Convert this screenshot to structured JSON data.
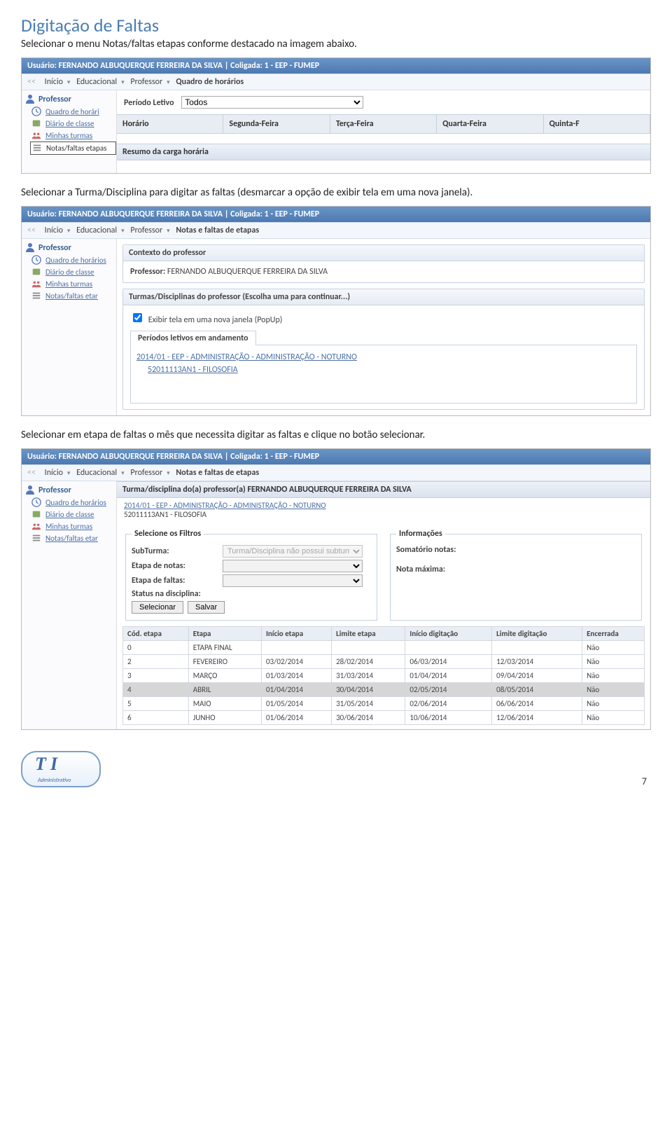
{
  "doc": {
    "title": "Digitação de Faltas",
    "intro1": "Selecionar o menu Notas/faltas etapas conforme destacado na imagem abaixo.",
    "intro2": "Selecionar a Turma/Disciplina para digitar as faltas (desmarcar a opção de exibir tela em uma nova janela).",
    "intro3": "Selecionar em etapa de faltas o mês que necessita digitar as faltas e clique no botão selecionar.",
    "page_number": "7",
    "logo_sub": "Administrativo"
  },
  "user_bar": "Usuário: FERNANDO ALBUQUERQUE FERREIRA DA SILVA  |  Coligada: 1 - EEP - FUMEP",
  "crumbs1": [
    "Início",
    "Educacional",
    "Professor",
    "Quadro de horários"
  ],
  "crumbs2": [
    "Início",
    "Educacional",
    "Professor",
    "Notas e faltas de etapas"
  ],
  "sidebar": {
    "group": "Professor",
    "items": [
      "Quadro de horári",
      "Diário de classe",
      "Minhas turmas",
      "Notas/faltas etapas"
    ],
    "items_b": [
      "Quadro de horários",
      "Diário de classe",
      "Minhas turmas",
      "Notas/faltas etar"
    ],
    "items_c": [
      "Quadro de horários",
      "Diário de classe",
      "Minhas turmas",
      "Notas/faltas etar"
    ]
  },
  "shot1": {
    "period_label": "Período Letivo",
    "period_value": "Todos",
    "cols": [
      "Horário",
      "Segunda-Feira",
      "Terça-Feira",
      "Quarta-Feira",
      "Quinta-F"
    ],
    "section": "Resumo da carga horária"
  },
  "shot2": {
    "panel1_title": "Contexto do professor",
    "prof_label": "Professor:",
    "prof_name": "FERNANDO ALBUQUERQUE FERREIRA DA SILVA",
    "panel2_title": "Turmas/Disciplinas do professor (Escolha uma para continuar...)",
    "chk_label": "Exibir tela em uma nova janela (PopUp)",
    "tab_label": "Períodos letivos em andamento",
    "row1": "2014/01 - EEP - ADMINISTRAÇÃO - ADMINISTRAÇÃO - NOTURNO",
    "row2": "52011113AN1 - FILOSOFIA"
  },
  "shot3": {
    "panel_title": "Turma/disciplina do(a) professor(a) FERNANDO ALBUQUERQUE FERREIRA DA SILVA",
    "line1": "2014/01 - EEP - ADMINISTRAÇÃO - ADMINISTRAÇÃO - NOTURNO",
    "line2": "52011113AN1 - FILOSOFIA",
    "filters_legend": "Selecione os Filtros",
    "info_legend": "Informações",
    "subturma_label": "SubTurma:",
    "subturma_value": "Turma/Disciplina não possui subturmas",
    "etapa_notas_label": "Etapa de notas:",
    "etapa_faltas_label": "Etapa de faltas:",
    "status_label": "Status na disciplina:",
    "somatorio_label": "Somatório notas:",
    "nota_max_label": "Nota máxima:",
    "btn_selecionar": "Selecionar",
    "btn_salvar": "Salvar",
    "grid_headers": [
      "Cód. etapa",
      "Etapa",
      "Início etapa",
      "Limite etapa",
      "Início digitação",
      "Limite digitação",
      "Encerrada"
    ],
    "grid_rows": [
      {
        "cod": "0",
        "etapa": "ETAPA FINAL",
        "ini": "",
        "lim": "",
        "idig": "",
        "ldig": "",
        "enc": "Não"
      },
      {
        "cod": "2",
        "etapa": "FEVEREIRO",
        "ini": "03/02/2014",
        "lim": "28/02/2014",
        "idig": "06/03/2014",
        "ldig": "12/03/2014",
        "enc": "Não"
      },
      {
        "cod": "3",
        "etapa": "MARÇO",
        "ini": "01/03/2014",
        "lim": "31/03/2014",
        "idig": "01/04/2014",
        "ldig": "09/04/2014",
        "enc": "Não"
      },
      {
        "cod": "4",
        "etapa": "ABRIL",
        "ini": "01/04/2014",
        "lim": "30/04/2014",
        "idig": "02/05/2014",
        "ldig": "08/05/2014",
        "enc": "Não",
        "hl": true
      },
      {
        "cod": "5",
        "etapa": "MAIO",
        "ini": "01/05/2014",
        "lim": "31/05/2014",
        "idig": "02/06/2014",
        "ldig": "06/06/2014",
        "enc": "Não"
      },
      {
        "cod": "6",
        "etapa": "JUNHO",
        "ini": "01/06/2014",
        "lim": "30/06/2014",
        "idig": "10/06/2014",
        "ldig": "12/06/2014",
        "enc": "Não"
      }
    ]
  }
}
